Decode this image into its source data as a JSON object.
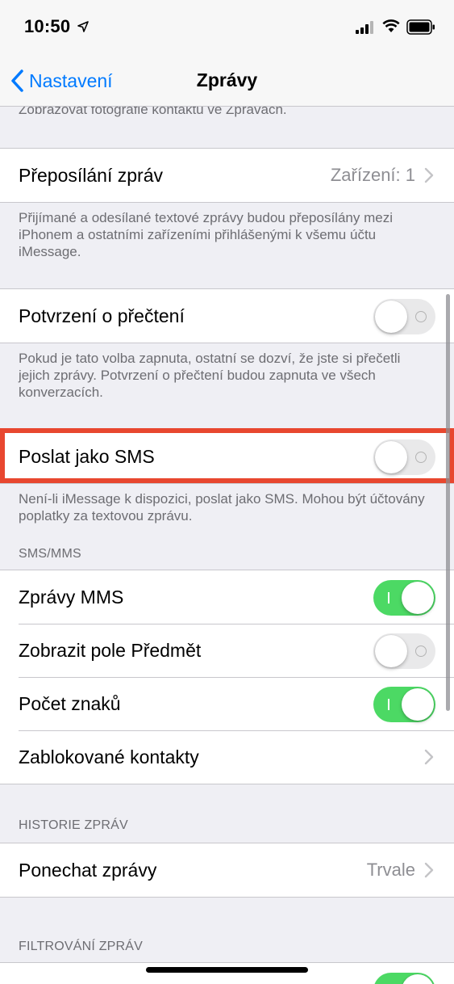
{
  "status": {
    "time": "10:50"
  },
  "nav": {
    "back_label": "Nastavení",
    "title": "Zprávy"
  },
  "sections": {
    "contact_photos_footer": "Zobrazovat fotografie kontaktu ve Zprávách.",
    "forwarding": {
      "label": "Přeposílání zpráv",
      "value": "Zařízení: 1",
      "footer": "Přijímané a odesílané textové zprávy budou přeposílány mezi iPhonem a ostatními zařízeními přihlášenými k všemu účtu iMessage."
    },
    "read_receipts": {
      "label": "Potvrzení o přečtení",
      "enabled": false,
      "footer": "Pokud je tato volba zapnuta, ostatní se dozví, že jste si přečetli jejich zprávy. Potvrzení o přečtení budou zapnuta ve všech konverzacích."
    },
    "send_as_sms": {
      "label": "Poslat jako SMS",
      "enabled": false,
      "footer": "Není-li iMessage k dispozici, poslat jako SMS. Mohou být účtovány poplatky za textovou zprávu."
    },
    "sms_mms": {
      "header": "SMS/MMS",
      "rows": [
        {
          "label": "Zprávy MMS",
          "enabled": true
        },
        {
          "label": "Zobrazit pole Předmět",
          "enabled": false
        },
        {
          "label": "Počet znaků",
          "enabled": true
        },
        {
          "label": "Zablokované kontakty"
        }
      ]
    },
    "history": {
      "header": "HISTORIE ZPRÁV",
      "keep_label": "Ponechat zprávy",
      "keep_value": "Trvale"
    },
    "filtering": {
      "header": "FILTROVÁNÍ ZPRÁV"
    }
  },
  "colors": {
    "accent": "#007aff",
    "toggle_on": "#4cd964",
    "highlight": "#e8472f"
  }
}
